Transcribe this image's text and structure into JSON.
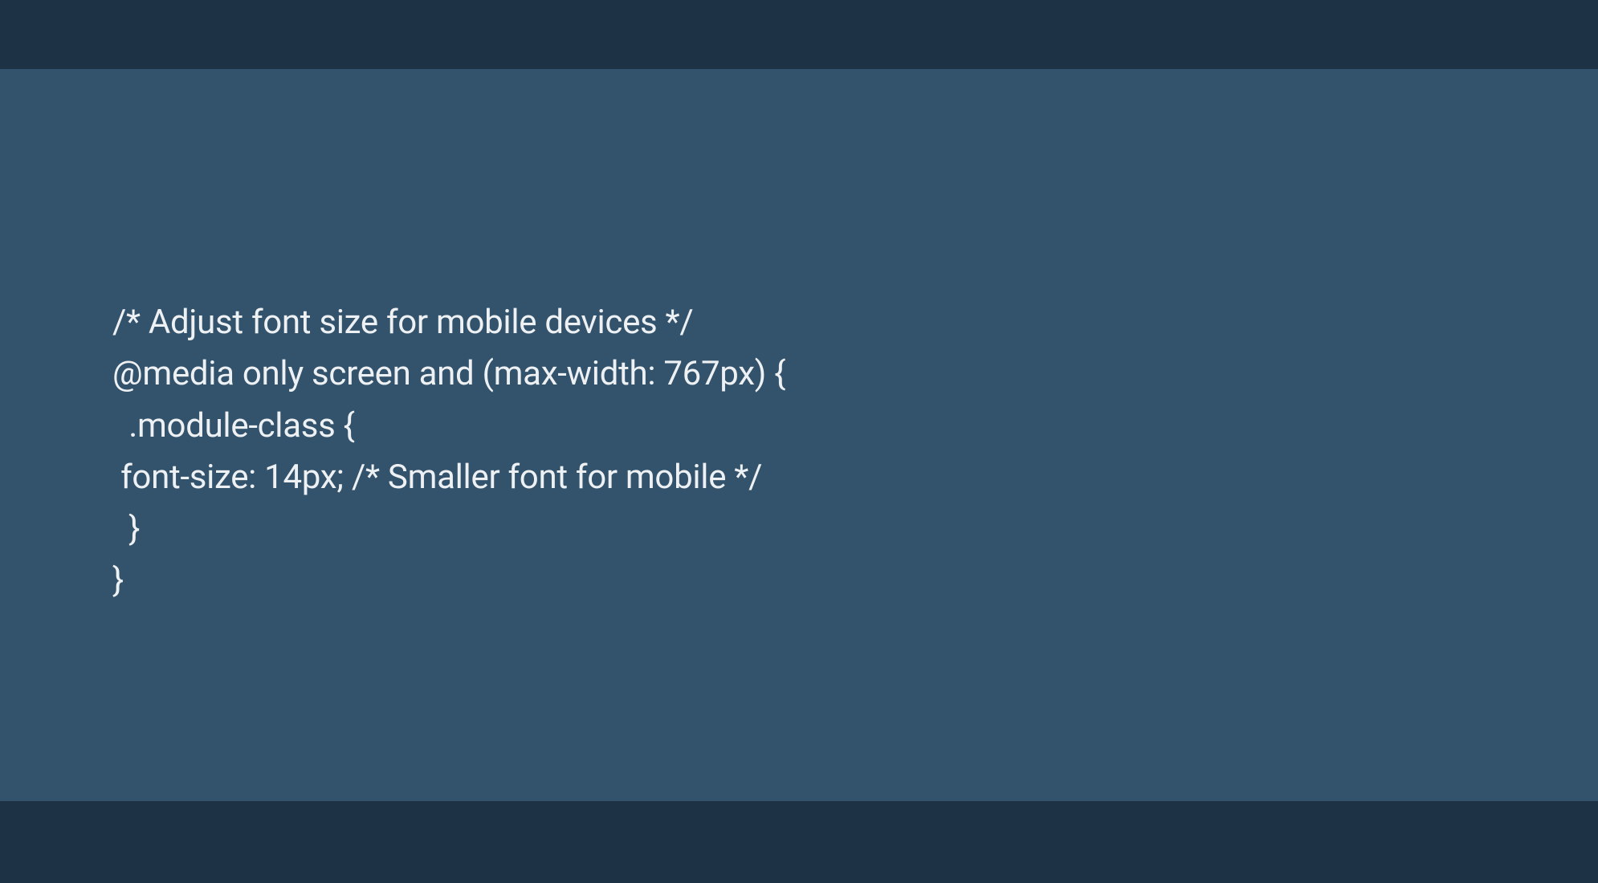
{
  "code": {
    "line1": "/* Adjust font size for mobile devices */",
    "line2": "@media only screen and (max-width: 767px) {",
    "line3": "  .module-class {",
    "line4": " font-size: 14px; /* Smaller font for mobile */",
    "line5": "  }",
    "line6": "}"
  }
}
